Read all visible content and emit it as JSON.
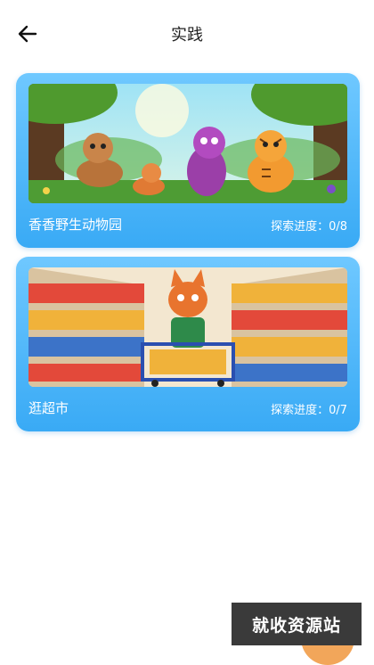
{
  "header": {
    "title": "实践",
    "back_icon": "arrow-left-icon"
  },
  "cards": [
    {
      "name": "香香野生动物园",
      "progress_label": "探索进度：0/8",
      "image": "cartoon-animals-forest"
    },
    {
      "name": "逛超市",
      "progress_label": "探索进度：0/7",
      "image": "cartoon-fox-supermarket"
    }
  ],
  "watermark": {
    "text": "就收资源站"
  },
  "colors": {
    "card_top": "#6fc8ff",
    "card_bottom": "#39aaf5"
  }
}
